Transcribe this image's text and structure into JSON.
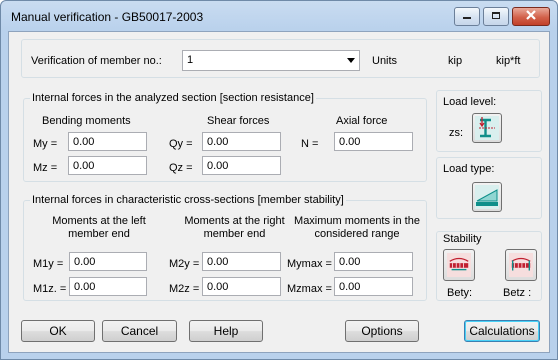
{
  "window": {
    "title": "Manual verification - GB50017-2003"
  },
  "member": {
    "label": "Verification of member no.:",
    "value": "1",
    "units_label": "Units",
    "unit_force": "kip",
    "unit_moment": "kip*ft"
  },
  "section": {
    "title": "Internal forces in the analyzed section [section resistance]",
    "bending_header": "Bending moments",
    "shear_header": "Shear forces",
    "axial_header": "Axial force",
    "my_label": "My =",
    "my_value": "0.00",
    "mz_label": "Mz =",
    "mz_value": "0.00",
    "qy_label": "Qy =",
    "qy_value": "0.00",
    "qz_label": "Qz =",
    "qz_value": "0.00",
    "n_label": "N =",
    "n_value": "0.00"
  },
  "stability": {
    "title": "Internal forces in characteristic cross-sections [member stability]",
    "left_header_1": "Moments at the left",
    "left_header_2": "member end",
    "right_header_1": "Moments at the right",
    "right_header_2": "member end",
    "max_header_1": "Maximum moments in the",
    "max_header_2": "considered range",
    "m1y_label": "M1y =",
    "m1y_value": "0.00",
    "m1z_label": "M1z. =",
    "m1z_value": "0.00",
    "m2y_label": "M2y =",
    "m2y_value": "0.00",
    "m2z_label": "M2z =",
    "m2z_value": "0.00",
    "mymax_label": "Mymax =",
    "mymax_value": "0.00",
    "mzmax_label": "Mzmax =",
    "mzmax_value": "0.00"
  },
  "side": {
    "load_level_title": "Load level:",
    "zs_label": "zs:",
    "load_type_title": "Load type:",
    "stability_title": "Stability",
    "bety_label": "Bety:",
    "betz_label": "Betz :"
  },
  "buttons": {
    "ok": "OK",
    "cancel": "Cancel",
    "help": "Help",
    "options": "Options",
    "calculations": "Calculations"
  },
  "icons": {
    "minimize": "minimize-icon",
    "maximize": "maximize-icon",
    "close": "close-icon",
    "dropdown": "chevron-down-icon",
    "load_level": "i-beam-load-level-icon",
    "load_type": "trapezoidal-load-icon",
    "bety": "beam-stability-y-icon",
    "betz": "beam-stability-z-icon"
  },
  "colors": {
    "title_bar": "#b9d1ec",
    "dialog_bg": "#f0f0f0",
    "icon_teal": "#0e8f8a",
    "icon_red": "#c02030"
  }
}
